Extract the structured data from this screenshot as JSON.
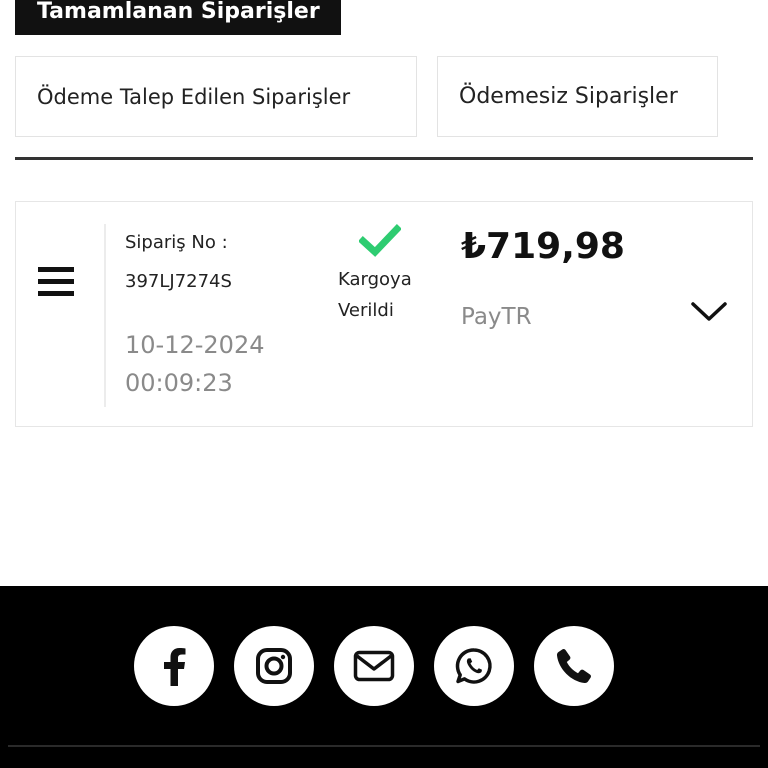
{
  "tabs": {
    "active_label": "Tamamlanan Siparişler",
    "filters": [
      {
        "label": "Ödeme Talep Edilen Siparişler"
      },
      {
        "label": "Ödemesiz Siparişler"
      }
    ]
  },
  "order": {
    "number_label": "Sipariş No :",
    "number": "397LJ7274S",
    "date": "10-12-2024",
    "time": "00:09:23",
    "status": "Kargoya Verildi",
    "status_icon": "check-icon",
    "status_color": "#2ecc71",
    "price": "₺719,98",
    "payment_method": "PayTR"
  },
  "footer": {
    "social": [
      {
        "icon": "facebook-icon"
      },
      {
        "icon": "instagram-icon"
      },
      {
        "icon": "mail-icon"
      },
      {
        "icon": "whatsapp-icon"
      },
      {
        "icon": "phone-icon"
      }
    ]
  },
  "colors": {
    "primary": "#111111",
    "muted_text": "#8a8a8a",
    "success": "#2ecc71",
    "footer_bg": "#000000"
  }
}
